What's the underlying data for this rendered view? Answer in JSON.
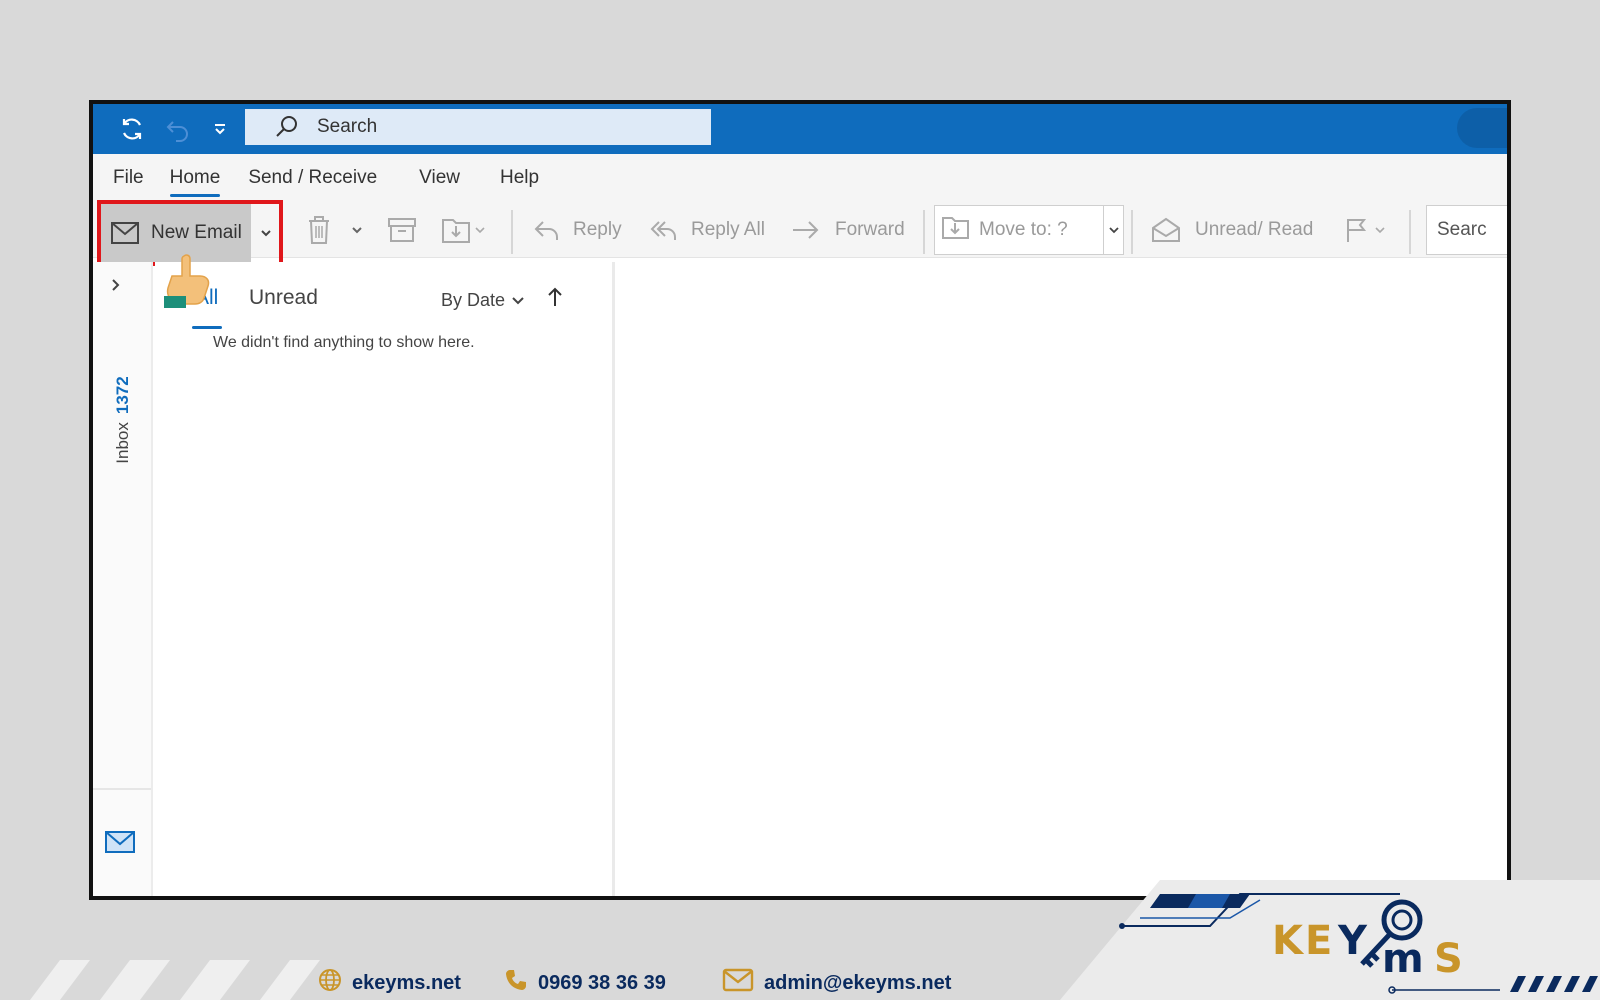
{
  "titlebar": {
    "search_placeholder": "Search",
    "icons": [
      "sync-icon",
      "undo-icon",
      "quick-access-dropdown-icon"
    ]
  },
  "menu_tabs": [
    {
      "label": "File",
      "active": false
    },
    {
      "label": "Home",
      "active": true
    },
    {
      "label": "Send / Receive",
      "active": false
    },
    {
      "label": "View",
      "active": false
    },
    {
      "label": "Help",
      "active": false
    }
  ],
  "ribbon": {
    "new_email": "New Email",
    "reply": "Reply",
    "reply_all": "Reply All",
    "forward": "Forward",
    "move_to": "Move to: ?",
    "unread_read": "Unread/ Read",
    "search_partial": "Searc"
  },
  "nav_rail": {
    "inbox_label": "Inbox",
    "inbox_count": "1372"
  },
  "message_list": {
    "filter_all": "All",
    "filter_unread": "Unread",
    "sort_label": "By Date",
    "empty_message": "We didn't find anything to show here."
  },
  "footer": {
    "website": "ekeyms.net",
    "phone": "0969 38 36 39",
    "email": "admin@ekeyms.net",
    "brand_logo_text": "KEYMS"
  },
  "colors": {
    "titlebar": "#0f6cbd",
    "highlight_box": "#e0171b",
    "brand_navy": "#0a2a5e",
    "brand_gold": "#c9952a"
  }
}
